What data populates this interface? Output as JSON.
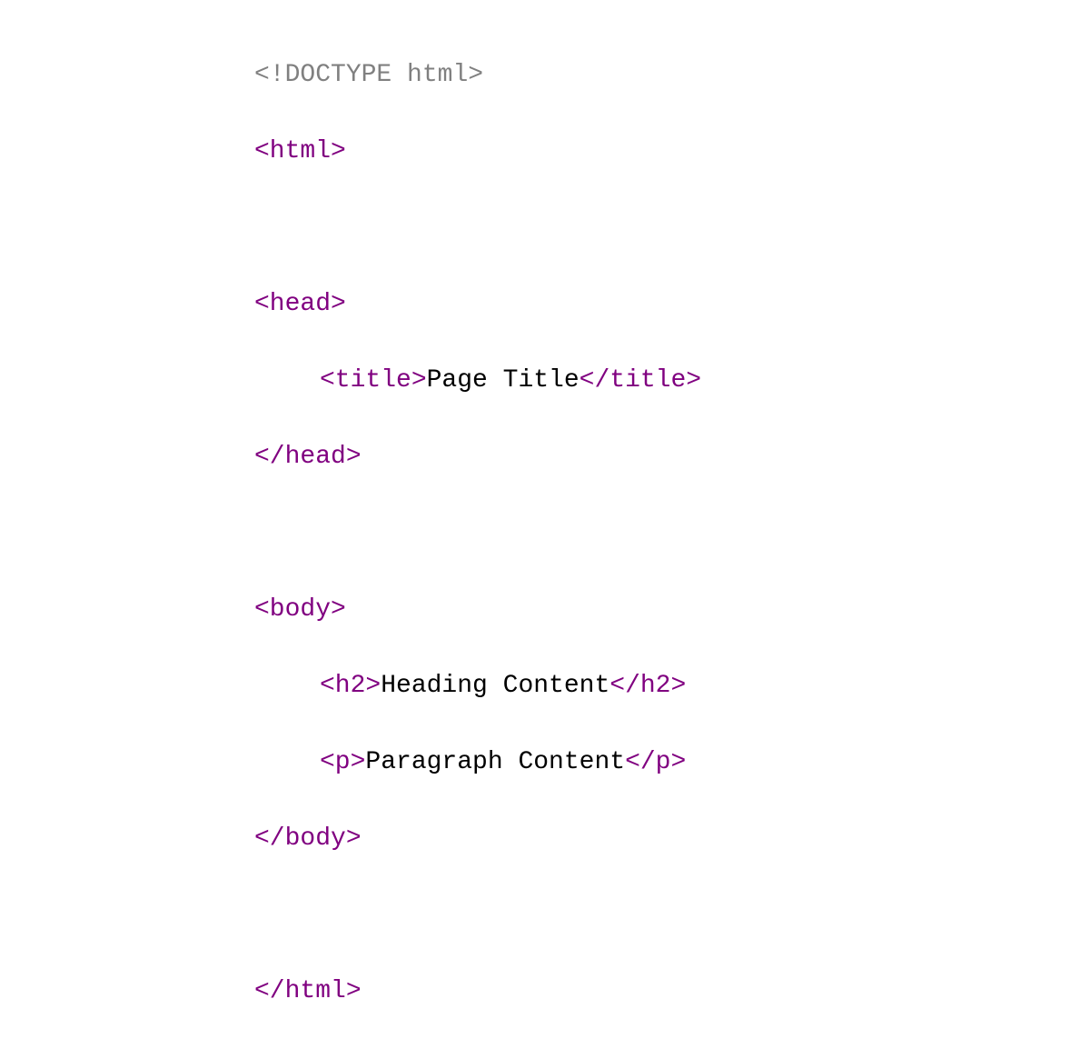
{
  "code": {
    "doctype_open": "<!",
    "doctype_text": "DOCTYPE html",
    "doctype_close": ">",
    "html_open": "<html>",
    "head_open": "<head>",
    "title_open": "<title>",
    "title_text": "Page Title",
    "title_close": "</title>",
    "head_close": "</head>",
    "body_open": "<body>",
    "h2_open": "<h2>",
    "h2_text": "Heading Content",
    "h2_close": "</h2>",
    "p_open": "<p>",
    "p_text": "Paragraph Content",
    "p_close": "</p>",
    "body_close": "</body>",
    "html_close": "</html>"
  },
  "colors": {
    "comment": "#808080",
    "tag": "#800080",
    "text": "#000000"
  }
}
